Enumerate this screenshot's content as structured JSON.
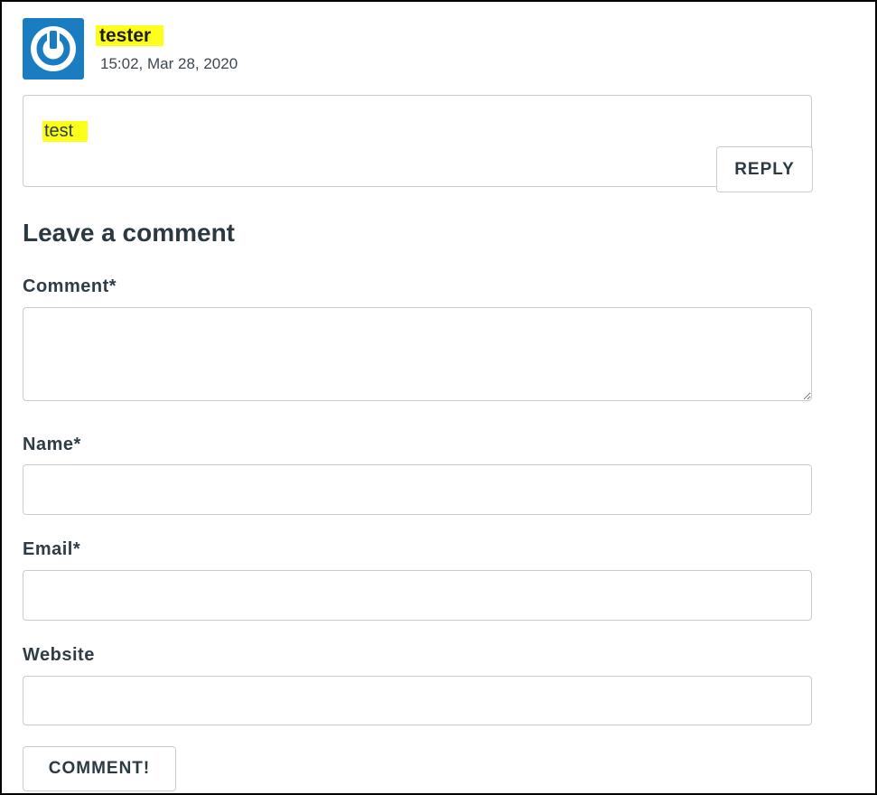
{
  "comment": {
    "author": "tester",
    "timestamp": "15:02, Mar 28, 2020",
    "text": "test",
    "reply_label": "REPLY",
    "avatar_icon": "power-icon"
  },
  "form": {
    "title": "Leave a comment",
    "comment_label": "Comment*",
    "name_label": "Name*",
    "email_label": "Email*",
    "website_label": "Website",
    "submit_label": "COMMENT!"
  },
  "colors": {
    "avatar_bg": "#1a7dc1",
    "highlight": "#fbff1a",
    "border": "#c9cdd0",
    "text": "#2b3a42"
  }
}
